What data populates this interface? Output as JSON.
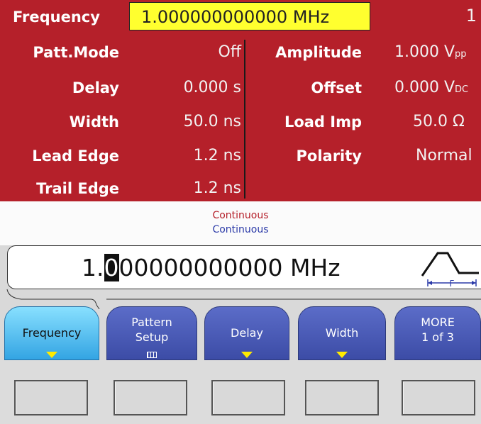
{
  "header": {
    "frequency_label": "Frequency",
    "frequency_value": "1.000000000000 MHz",
    "channel": "1"
  },
  "params_left": [
    {
      "label": "Patt.Mode",
      "value": "Off"
    },
    {
      "label": "Delay",
      "value": "0.000 s"
    },
    {
      "label": "Width",
      "value": "50.0 ns"
    },
    {
      "label": "Lead Edge",
      "value": "1.2 ns"
    },
    {
      "label": "Trail Edge",
      "value": "1.2 ns"
    }
  ],
  "params_right": [
    {
      "label": "Amplitude",
      "value": "1.000 V",
      "unit_sub": "pp"
    },
    {
      "label": "Offset",
      "value": "0.000 V",
      "unit_sub": "DC"
    },
    {
      "label": "Load Imp",
      "value": "50.0 Ω",
      "unit_sub": ""
    },
    {
      "label": "Polarity",
      "value": "Normal",
      "unit_sub": ""
    }
  ],
  "status": {
    "line1": "Continuous",
    "line2": "Continuous"
  },
  "entry": {
    "prefix": "1.",
    "cursor_digit": "0",
    "suffix": "00000000000 MHz",
    "waveform_label": "F"
  },
  "softkeys": [
    {
      "label": "Frequency",
      "line2": "",
      "indicator": "arrow"
    },
    {
      "label": "Pattern",
      "line2": "Setup",
      "indicator": "grid"
    },
    {
      "label": "Delay",
      "line2": "",
      "indicator": "arrow"
    },
    {
      "label": "Width",
      "line2": "",
      "indicator": "arrow"
    },
    {
      "label": "MORE",
      "line2": "1 of 3",
      "indicator": ""
    }
  ],
  "colors": {
    "panel_red": "#b5202a",
    "highlight_yellow": "#ffff2f",
    "softkey_blue": "#3c4ca6",
    "softkey_active": "#33a4e3",
    "status_line1": "#b5202a",
    "status_line2": "#2b3aa8"
  }
}
